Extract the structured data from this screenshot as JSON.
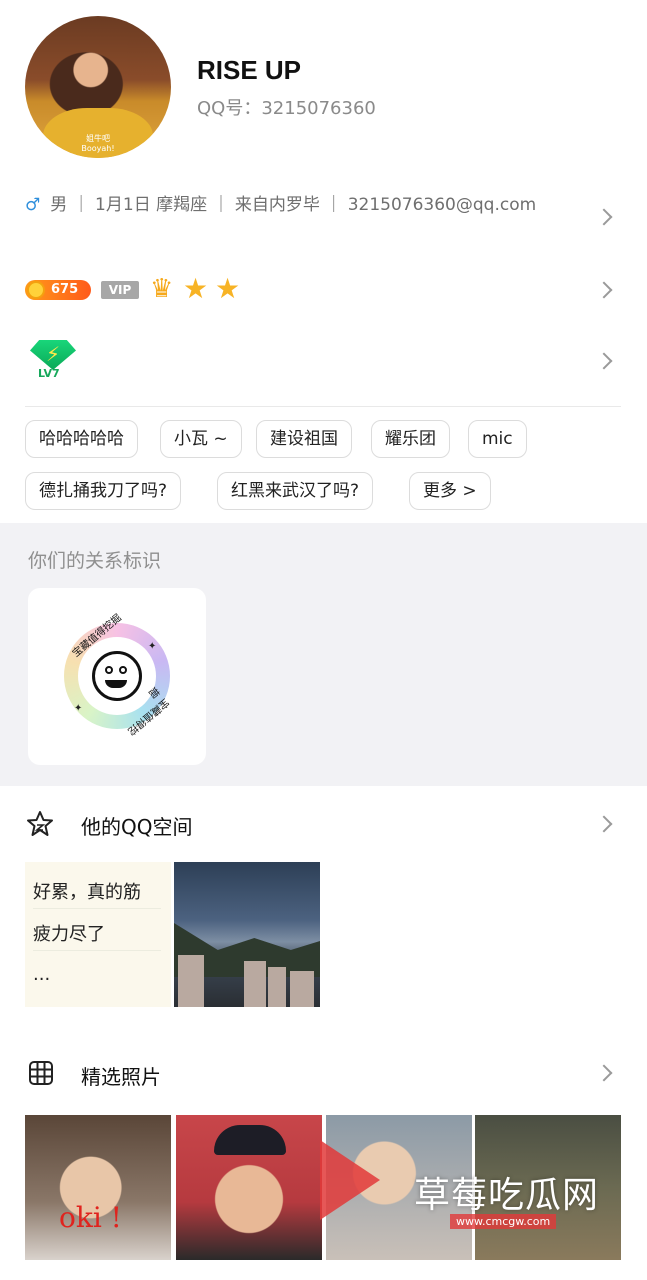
{
  "profile": {
    "nickname": "RISE UP",
    "qq_label": "QQ号：3215076360",
    "avatar_caption_1": "姐牛吧",
    "avatar_caption_2": "Booyah!",
    "gender_symbol": "♂",
    "info_line": "男 ｜ 1月1日  摩羯座 ｜ 来自内罗毕 ｜ 3215076360@qq.com"
  },
  "badges": {
    "coins": "675",
    "vip": "VIP",
    "level_label": "LV7",
    "crown_icon": "crown-icon",
    "star_icon": "star-icon"
  },
  "tags": [
    "哈哈哈哈哈",
    "小瓦 ~",
    "建设祖国",
    "耀乐团",
    "mic",
    "德扎捅我刀了吗?",
    "红黑来武汉了吗?",
    "更多 >"
  ],
  "relation": {
    "title": "你们的关系标识",
    "badge_text": "宝藏值得挖掘"
  },
  "qzone": {
    "title": "他的QQ空间",
    "mood_line1": "好累，真的筋",
    "mood_line2": "疲力尽了",
    "mood_line3": "..."
  },
  "photos": {
    "title": "精选照片",
    "photo1_text": "oki !"
  },
  "watermark": {
    "text": "草莓吃瓜网",
    "url": "www.cmcgw.com"
  },
  "colors": {
    "accent_male": "#2f8fdc",
    "coin": "#ff7a1a",
    "star": "#f7b325",
    "vip_gray": "#a7a7a7",
    "page_gray": "#f2f2f5"
  }
}
